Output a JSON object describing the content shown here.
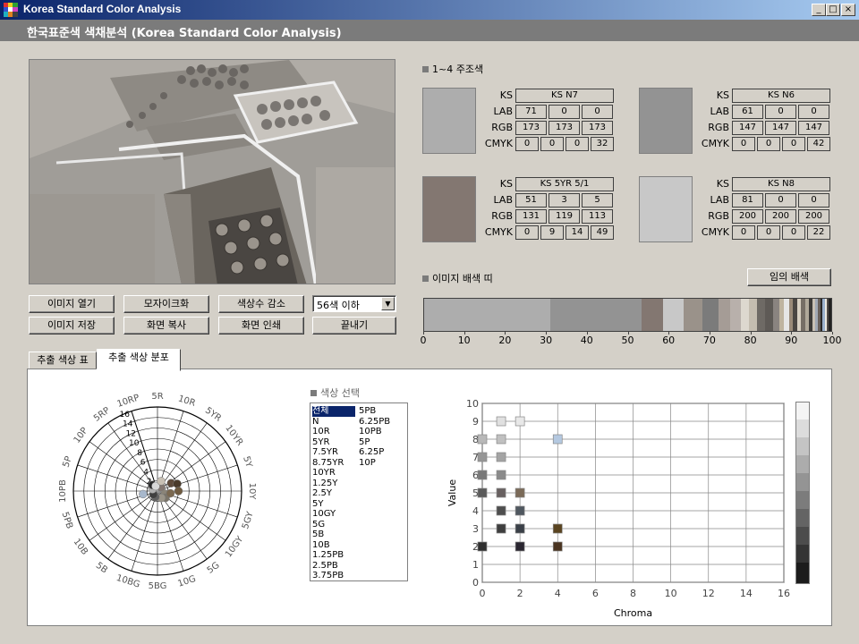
{
  "window": {
    "title": "Korea Standard Color Analysis"
  },
  "header": {
    "title": "한국표준색 색채분석 (Korea Standard Color Analysis)"
  },
  "buttons": {
    "open_image": "이미지 열기",
    "mosaic": "모자이크화",
    "reduce_colors": "색상수 감소",
    "save_image": "이미지 저장",
    "copy_screen": "화면 복사",
    "print_screen": "화면 인쇄",
    "exit": "끝내기",
    "random_scheme": "임의 배색"
  },
  "color_count_select": {
    "value": "56색 이하"
  },
  "main_colors": {
    "label": "1~4 주조색",
    "row_labels": {
      "ks": "KS",
      "lab": "LAB",
      "rgb": "RGB",
      "cmyk": "CMYK"
    },
    "items": [
      {
        "swatch": "#adadad",
        "ks": "KS N7",
        "lab": [
          "71",
          "0",
          "0"
        ],
        "rgb": [
          "173",
          "173",
          "173"
        ],
        "cmyk": [
          "0",
          "0",
          "0",
          "32"
        ]
      },
      {
        "swatch": "#939393",
        "ks": "KS N6",
        "lab": [
          "61",
          "0",
          "0"
        ],
        "rgb": [
          "147",
          "147",
          "147"
        ],
        "cmyk": [
          "0",
          "0",
          "0",
          "42"
        ]
      },
      {
        "swatch": "#837771",
        "ks": "KS 5YR 5/1",
        "lab": [
          "51",
          "3",
          "5"
        ],
        "rgb": [
          "131",
          "119",
          "113"
        ],
        "cmyk": [
          "0",
          "9",
          "14",
          "49"
        ]
      },
      {
        "swatch": "#c8c8c8",
        "ks": "KS N8",
        "lab": [
          "81",
          "0",
          "0"
        ],
        "rgb": [
          "200",
          "200",
          "200"
        ],
        "cmyk": [
          "0",
          "0",
          "0",
          "22"
        ]
      }
    ]
  },
  "color_strip": {
    "label": "이미지 배색 띠",
    "axis": [
      "0",
      "10",
      "20",
      "30",
      "40",
      "50",
      "60",
      "70",
      "80",
      "90",
      "100"
    ],
    "segments": [
      {
        "color": "#adadad",
        "pct": 31
      },
      {
        "color": "#939393",
        "pct": 22.5
      },
      {
        "color": "#837771",
        "pct": 5.5
      },
      {
        "color": "#c8c8c8",
        "pct": 5
      },
      {
        "color": "#9a928a",
        "pct": 4.5
      },
      {
        "color": "#7b7b7b",
        "pct": 4
      },
      {
        "color": "#a59c96",
        "pct": 3
      },
      {
        "color": "#b8b0ab",
        "pct": 2.5
      },
      {
        "color": "#ddd8cf",
        "pct": 2
      },
      {
        "color": "#c4bdb0",
        "pct": 2
      },
      {
        "color": "#6e6a65",
        "pct": 2
      },
      {
        "color": "#5e5a56",
        "pct": 2
      },
      {
        "color": "#8a8480",
        "pct": 1.5
      },
      {
        "color": "#bfb4a0",
        "pct": 1.2
      },
      {
        "color": "#e6e6e6",
        "pct": 1.2
      },
      {
        "color": "#9a8a78",
        "pct": 1
      },
      {
        "color": "#4a4642",
        "pct": 1
      },
      {
        "color": "#d8d0c2",
        "pct": 1
      },
      {
        "color": "#766e66",
        "pct": 1
      },
      {
        "color": "#b0a89a",
        "pct": 1
      },
      {
        "color": "#3c3a38",
        "pct": 0.8
      },
      {
        "color": "#c8c0b4",
        "pct": 0.8
      },
      {
        "color": "#a0a8b4",
        "pct": 0.6
      },
      {
        "color": "#68605a",
        "pct": 0.6
      },
      {
        "color": "#2a2828",
        "pct": 0.6
      },
      {
        "color": "#9ab0cc",
        "pct": 0.5
      },
      {
        "color": "#ece8e0",
        "pct": 0.5
      },
      {
        "color": "#504a46",
        "pct": 0.5
      },
      {
        "color": "#222222",
        "pct": 0.6
      }
    ]
  },
  "tabs": [
    {
      "label": "추출 색상 표"
    },
    {
      "label": "추출 색상 분포"
    }
  ],
  "hue_wheel": {
    "hue_labels": [
      "5R",
      "10R",
      "5YR",
      "10YR",
      "5Y",
      "10Y",
      "5GY",
      "10GY",
      "5G",
      "10G",
      "5BG",
      "10BG",
      "5B",
      "10B",
      "5PB",
      "10PB",
      "5P",
      "10P",
      "5RP",
      "10RP"
    ],
    "chroma_ticks": [
      "2",
      "4",
      "6",
      "8",
      "10",
      "12",
      "14",
      "16"
    ],
    "points": [
      {
        "a": 0,
        "c": 0.5,
        "color": "#adadad"
      },
      {
        "a": 0,
        "c": 0.3,
        "color": "#939393"
      },
      {
        "a": 0,
        "c": 0.8,
        "color": "#c8c8c8"
      },
      {
        "a": 45,
        "c": 1,
        "color": "#837771"
      },
      {
        "a": 60,
        "c": 3,
        "color": "#5e4a3a"
      },
      {
        "a": 70,
        "c": 4,
        "color": "#4a3a2a"
      },
      {
        "a": 90,
        "c": 4,
        "color": "#6e5a40"
      },
      {
        "a": 110,
        "c": 1.5,
        "color": "#8a8478"
      },
      {
        "a": 130,
        "c": 2,
        "color": "#7a7468"
      },
      {
        "a": 150,
        "c": 1.5,
        "color": "#9a9488"
      },
      {
        "a": 200,
        "c": 1.2,
        "color": "#606060"
      },
      {
        "a": 230,
        "c": 1,
        "color": "#404040"
      },
      {
        "a": 258,
        "c": 2.8,
        "color": "#a8b8cc"
      },
      {
        "a": 290,
        "c": 1,
        "color": "#b0b0b0"
      },
      {
        "a": 320,
        "c": 1.5,
        "color": "#2a2a2a"
      },
      {
        "a": 340,
        "c": 1,
        "color": "#d8d8d8"
      },
      {
        "a": 20,
        "c": 2,
        "color": "#c8c0b4"
      },
      {
        "a": 100,
        "c": 2.5,
        "color": "#7a6850"
      }
    ]
  },
  "hue_select": {
    "label": "색상 선택",
    "col1": [
      "전체",
      "N",
      "10R",
      "5YR",
      "7.5YR",
      "8.75YR",
      "10YR",
      "1.25Y",
      "2.5Y",
      "5Y",
      "10GY",
      "5G",
      "5B",
      "10B",
      "1.25PB",
      "2.5PB",
      "3.75PB"
    ],
    "col2": [
      "5PB",
      "6.25PB",
      "10PB",
      "5P",
      "6.25P",
      "10P"
    ],
    "selected": "전체"
  },
  "value_chroma_chart": {
    "xlabel": "Chroma",
    "ylabel": "Value",
    "xlim": [
      0,
      16
    ],
    "ylim": [
      0,
      10
    ],
    "x_ticks": [
      "0",
      "2",
      "4",
      "6",
      "8",
      "10",
      "12",
      "14",
      "16"
    ],
    "y_ticks": [
      "0",
      "1",
      "2",
      "3",
      "4",
      "5",
      "6",
      "7",
      "8",
      "9",
      "10"
    ],
    "points": [
      {
        "x": 0,
        "y": 2,
        "color": "#2e2e2e"
      },
      {
        "x": 0,
        "y": 5,
        "color": "#5a5a5a"
      },
      {
        "x": 0,
        "y": 6,
        "color": "#787878"
      },
      {
        "x": 0,
        "y": 7,
        "color": "#969696"
      },
      {
        "x": 0,
        "y": 8,
        "color": "#b8b8b8"
      },
      {
        "x": 1,
        "y": 3,
        "color": "#3e3e3e"
      },
      {
        "x": 1,
        "y": 4,
        "color": "#4e4e4e"
      },
      {
        "x": 1,
        "y": 5,
        "color": "#686060"
      },
      {
        "x": 1,
        "y": 6,
        "color": "#8a8a8a"
      },
      {
        "x": 1,
        "y": 7,
        "color": "#a4a4a4"
      },
      {
        "x": 1,
        "y": 8,
        "color": "#c0c0c0"
      },
      {
        "x": 1,
        "y": 9,
        "color": "#e0e0e0"
      },
      {
        "x": 2,
        "y": 2,
        "color": "#2a2630"
      },
      {
        "x": 2,
        "y": 3,
        "color": "#3a4048"
      },
      {
        "x": 2,
        "y": 4,
        "color": "#505860"
      },
      {
        "x": 2,
        "y": 5,
        "color": "#7a6a58"
      },
      {
        "x": 2,
        "y": 9,
        "color": "#e8e8e8"
      },
      {
        "x": 4,
        "y": 2,
        "color": "#4a3420"
      },
      {
        "x": 4,
        "y": 3,
        "color": "#5a4420"
      },
      {
        "x": 4,
        "y": 8,
        "color": "#b4c8e0"
      }
    ]
  }
}
